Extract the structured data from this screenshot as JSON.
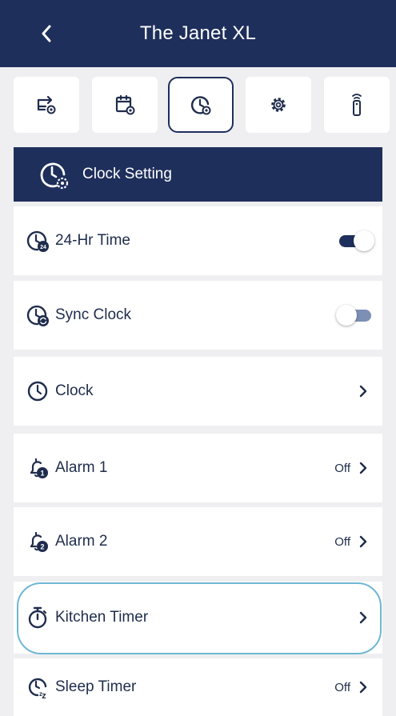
{
  "header": {
    "title": "The Janet XL",
    "back_icon": "chevron-left-icon"
  },
  "toolbar": {
    "items": [
      {
        "icon": "input-settings-icon",
        "active": false
      },
      {
        "icon": "calendar-settings-icon",
        "active": false
      },
      {
        "icon": "clock-settings-icon",
        "active": true
      },
      {
        "icon": "gear-icon",
        "active": false
      },
      {
        "icon": "remote-control-icon",
        "active": false
      }
    ]
  },
  "section": {
    "title": "Clock Setting",
    "icon": "clock-settings-icon"
  },
  "rows": [
    {
      "label": "24-Hr Time",
      "icon": "clock-24-icon",
      "control": "toggle",
      "on": true
    },
    {
      "label": "Sync Clock",
      "icon": "clock-sync-icon",
      "control": "toggle",
      "on": false
    },
    {
      "label": "Clock",
      "icon": "clock-icon",
      "control": "chevron"
    },
    {
      "label": "Alarm 1",
      "icon": "alarm-1-icon",
      "control": "chevron",
      "status": "Off"
    },
    {
      "label": "Alarm 2",
      "icon": "alarm-2-icon",
      "control": "chevron",
      "status": "Off"
    },
    {
      "label": "Kitchen Timer",
      "icon": "stopwatch-icon",
      "control": "chevron",
      "highlighted": true
    },
    {
      "label": "Sleep Timer",
      "icon": "sleep-timer-icon",
      "control": "chevron",
      "status": "Off"
    }
  ],
  "colors": {
    "primary": "#1f2f5c",
    "background": "#efeff1",
    "toggle_off": "#7d8fb5",
    "highlight": "#6fb7d4"
  }
}
